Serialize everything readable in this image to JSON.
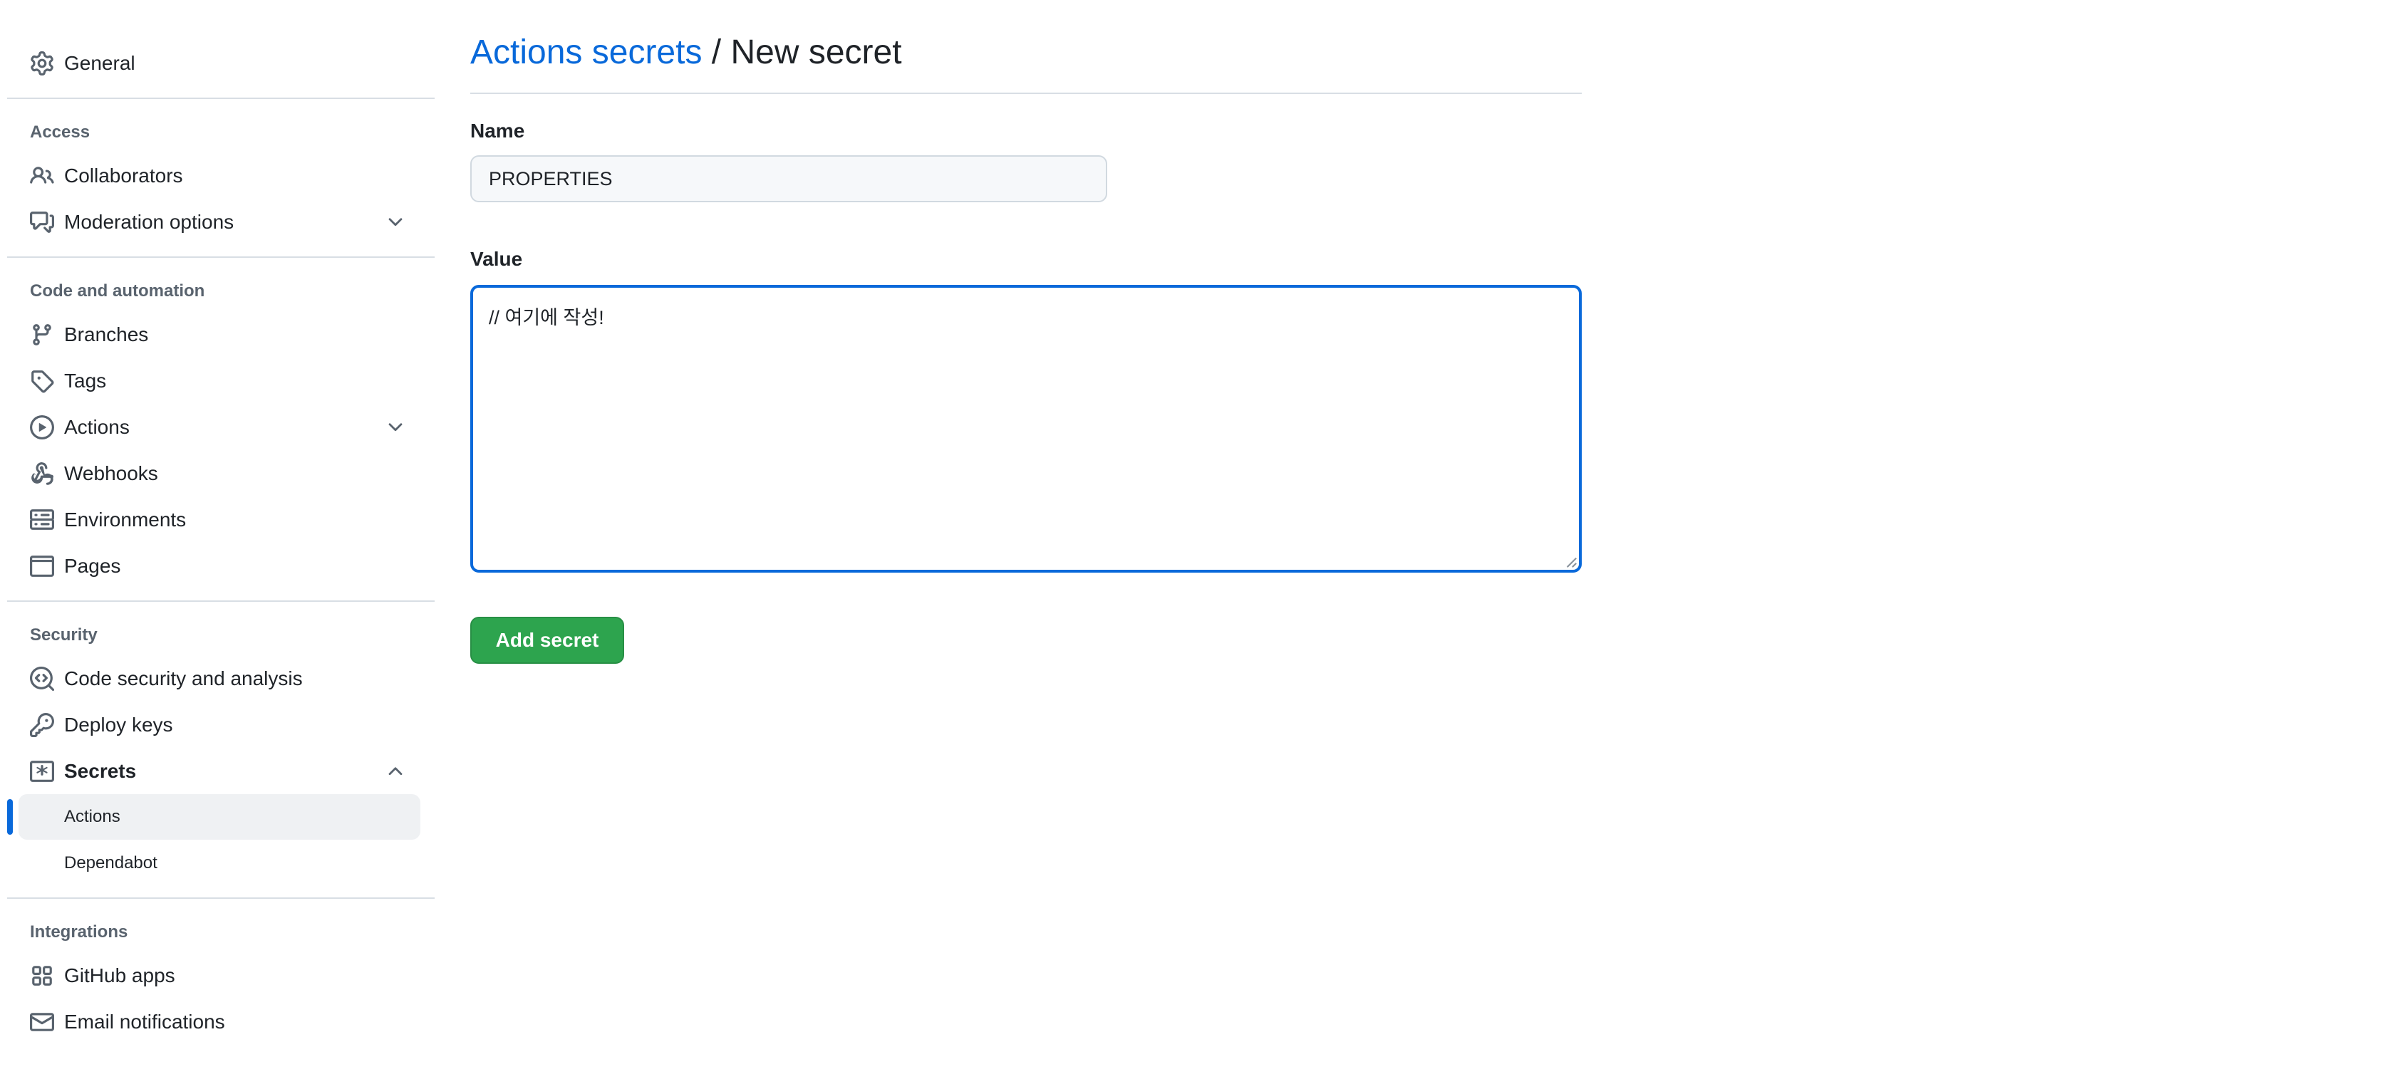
{
  "sidebar": {
    "general": {
      "label": "General",
      "icon": "gear-icon"
    },
    "sections": {
      "access": "Access",
      "code_automation": "Code and automation",
      "security": "Security",
      "integrations": "Integrations"
    },
    "access_items": [
      {
        "label": "Collaborators",
        "icon": "people-icon"
      },
      {
        "label": "Moderation options",
        "icon": "comment-discussion-icon",
        "expandable": true
      }
    ],
    "code_items": [
      {
        "label": "Branches",
        "icon": "git-branch-icon"
      },
      {
        "label": "Tags",
        "icon": "tag-icon"
      },
      {
        "label": "Actions",
        "icon": "play-icon",
        "expandable": true
      },
      {
        "label": "Webhooks",
        "icon": "webhook-icon"
      },
      {
        "label": "Environments",
        "icon": "server-icon"
      },
      {
        "label": "Pages",
        "icon": "browser-icon"
      }
    ],
    "security_items": [
      {
        "label": "Code security and analysis",
        "icon": "codescan-icon"
      },
      {
        "label": "Deploy keys",
        "icon": "key-icon"
      },
      {
        "label": "Secrets",
        "icon": "asterisk-box-icon",
        "expanded": true
      }
    ],
    "secrets_sub": [
      {
        "label": "Actions",
        "active": true
      },
      {
        "label": "Dependabot",
        "active": false
      }
    ],
    "integration_items": [
      {
        "label": "GitHub apps",
        "icon": "apps-icon"
      },
      {
        "label": "Email notifications",
        "icon": "mail-icon"
      }
    ]
  },
  "main": {
    "breadcrumb_link": "Actions secrets",
    "breadcrumb_sep": " / ",
    "title": "New secret",
    "name_label": "Name",
    "name_value": "PROPERTIES",
    "value_label": "Value",
    "value_text": "// 여기에 작성!",
    "submit_label": "Add secret"
  },
  "colors": {
    "accent": "#0969da",
    "button": "#2da44e",
    "text": "#1f2328",
    "muted": "#59636e"
  }
}
